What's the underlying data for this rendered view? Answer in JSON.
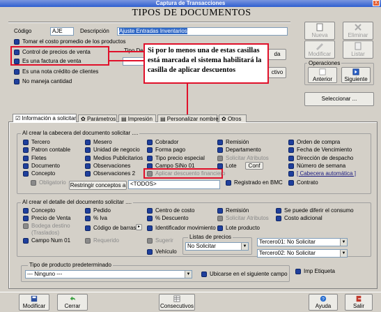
{
  "window": {
    "title": "Captura de Transacciones",
    "close_label": "X"
  },
  "header": {
    "title": "TIPOS DE DOCUMENTOS"
  },
  "form": {
    "codigo_label": "Código",
    "codigo_value": "AJE",
    "descripcion_label": "Descripción",
    "descripcion_value": "Ajuste Entradas Inventarios",
    "tomar_costo": "Tomar el costo promedio de los productos",
    "control_precios": "Control de precios de venta",
    "factura_venta": "Es una factura de venta",
    "nota_credito": "Es una nota crédito de clientes",
    "no_maneja": "No maneja cantidad",
    "tipo_de_label": "Tipo De",
    "hidden_btn1": "da",
    "hidden_btn2": "ctivo"
  },
  "callout": {
    "text": "Si por lo menos una de estas casillas está marcada el sistema habilitará la casilla de aplicar descuentos"
  },
  "toolbar": {
    "nueva": "Nueva",
    "eliminar": "Eliminar",
    "modificar": "Modificar",
    "listar": "Listar",
    "operaciones": "Operaciones",
    "anterior": "Anterior",
    "siguiente": "Siguiente",
    "seleccionar": "Seleccionar ..."
  },
  "tabs": [
    {
      "label": "Información a solicitar"
    },
    {
      "label": "Parámetros"
    },
    {
      "label": "Impresión"
    },
    {
      "label": "Personalizar nombres"
    },
    {
      "label": "Otros"
    }
  ],
  "cabecera": {
    "title": "Al crear la cabecera del documento solicitar ....",
    "col1": [
      "Tercero",
      "Patron contable",
      "Fletes",
      "Documento",
      "Concepto"
    ],
    "col2": [
      "Mesero",
      "Unidad de negocio",
      "Medios Publicitarios",
      "Observaciones",
      "Observaciones 2"
    ],
    "col3": [
      "Cobrador",
      "Forma pago",
      "Tipo precio especial",
      "Campo SiNo 01",
      "Aplicar descuento financiero"
    ],
    "col4": [
      "Remisión",
      "Departamento",
      "Solicitar Atributos",
      "Lote"
    ],
    "col5": [
      "Orden de compra",
      "Fecha de Vencimiento",
      "Dirección de despacho",
      "Número de semana",
      "[ Cabecera automática ]"
    ],
    "conf_btn": "Conf",
    "obligatorio": "Obligatorio",
    "restringir_btn": "Restringir conceptos a",
    "todos_value": "<TODOS>",
    "registrado": "Registrado en BMC",
    "contrato": "Contrato"
  },
  "detalle": {
    "title": "Al crear  el detalle del documento solicitar ....",
    "concepto": "Concepto",
    "precio_venta": "Precio de Venta",
    "bodega": "Bodega destino",
    "traslados": "(Traslados)",
    "campo_num": "Campo Num 01",
    "pedido": "Pedido",
    "iva": "% Iva",
    "codigo_barras": "Código de barras",
    "requerido": "Requerido",
    "centro_costo": "Centro de costo",
    "descuento": "% Descuento",
    "identificador": "Identificador movimiento",
    "sugerir": "Sugerir",
    "vehiculo": "Vehículo",
    "remision": "Remisión",
    "solicitar_atributos": "Solicitar Atributos",
    "lote_producto": "Lote producto",
    "diferir": "Se puede diferir el consumo",
    "costo_adicional": "Costo adicional",
    "listas_label": "Listas de precios",
    "listas_value": "No Solicitar",
    "tercero01": "Tercero01: No Solicitar",
    "tercero02": "Tercero02: No Solicitar"
  },
  "tipo_producto": {
    "title": "Tipo de producto predeterminado",
    "value": "--- Ninguno ---",
    "ubicarse": "Ubicarse en el siguiente campo",
    "imp_etiqueta": "Imp Etiqueta"
  },
  "bottom": {
    "modificar": "Modificar",
    "cerrar": "Cerrar",
    "consecutivos": "Consecutivos",
    "ayuda": "Ayuda",
    "salir": "Salir"
  },
  "colors": {
    "accent": "#3169c6",
    "annotation": "#e0102a",
    "checkbox": "#1f3f9c"
  }
}
